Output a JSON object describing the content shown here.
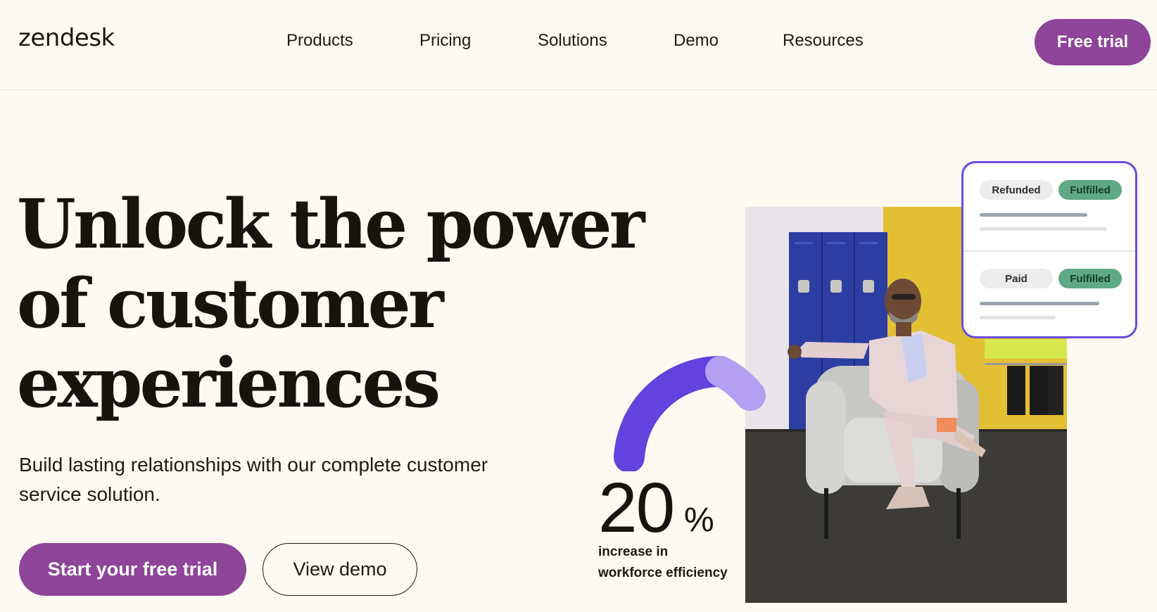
{
  "header": {
    "logo": "zendesk",
    "nav": [
      "Products",
      "Pricing",
      "Solutions",
      "Demo",
      "Resources"
    ],
    "cta": "Free trial"
  },
  "hero": {
    "title_lines": [
      "Unlock the power",
      "of customer",
      "experiences"
    ],
    "subtitle": "Build lasting relationships with our complete customer service solution.",
    "primary_cta": "Start your free trial",
    "secondary_cta": "View demo"
  },
  "stat": {
    "value": "20",
    "unit": "%",
    "label": "increase in workforce efficiency",
    "gauge_fraction": 0.25
  },
  "order_card": {
    "rows": [
      {
        "status_a": "Refunded",
        "status_b": "Fulfilled"
      },
      {
        "status_a": "Paid",
        "status_b": "Fulfilled"
      }
    ]
  },
  "colors": {
    "brand": "#8e4599",
    "accent_purple": "#6a4cde",
    "fulfilled_green": "#5fa888",
    "background": "#fdf9f3"
  }
}
